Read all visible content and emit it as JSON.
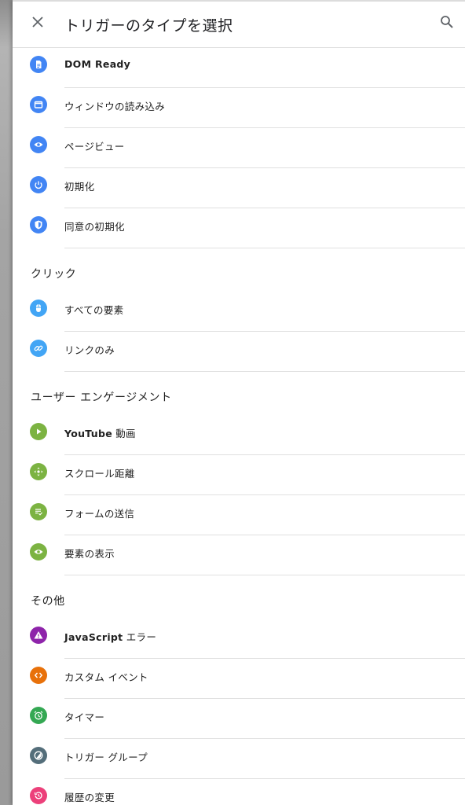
{
  "header": {
    "title": "トリガーのタイプを選択",
    "close_icon": "close-icon",
    "search_icon": "search-icon"
  },
  "page_load": {
    "items": [
      {
        "label": "DOM Ready",
        "icon": "document-icon",
        "color": "#4285f4"
      },
      {
        "label": "ウィンドウの読み込み",
        "icon": "window-icon",
        "color": "#4285f4"
      },
      {
        "label": "ページビュー",
        "icon": "eye-icon",
        "color": "#4285f4"
      },
      {
        "label": "初期化",
        "icon": "power-icon",
        "color": "#4285f4"
      },
      {
        "label": "同意の初期化",
        "icon": "shield-icon",
        "color": "#4285f4"
      }
    ]
  },
  "click": {
    "title": "クリック",
    "items": [
      {
        "label": "すべての要素",
        "icon": "mouse-icon",
        "color": "#42a5f5"
      },
      {
        "label": "リンクのみ",
        "icon": "link-icon",
        "color": "#42a5f5"
      }
    ]
  },
  "engagement": {
    "title": "ユーザー エンゲージメント",
    "items": [
      {
        "label_bold": "YouTube",
        "label_rest": " 動画",
        "icon": "play-icon",
        "color": "#7cb342"
      },
      {
        "label": "スクロール距離",
        "icon": "scroll-arrows-icon",
        "color": "#7cb342"
      },
      {
        "label": "フォームの送信",
        "icon": "form-submit-icon",
        "color": "#7cb342"
      },
      {
        "label": "要素の表示",
        "icon": "eye-icon",
        "color": "#7cb342"
      }
    ]
  },
  "other": {
    "title": "その他",
    "items": [
      {
        "label_bold": "JavaScript",
        "label_rest": " エラー",
        "icon": "warning-icon",
        "color": "#8e24aa"
      },
      {
        "label": "カスタム イベント",
        "icon": "code-icon",
        "color": "#e8710a"
      },
      {
        "label": "タイマー",
        "icon": "alarm-icon",
        "color": "#34a853"
      },
      {
        "label": "トリガー グループ",
        "icon": "trigger-group-icon",
        "color": "#546e7a"
      },
      {
        "label": "履歴の変更",
        "icon": "history-icon",
        "color": "#ec407a"
      }
    ]
  }
}
